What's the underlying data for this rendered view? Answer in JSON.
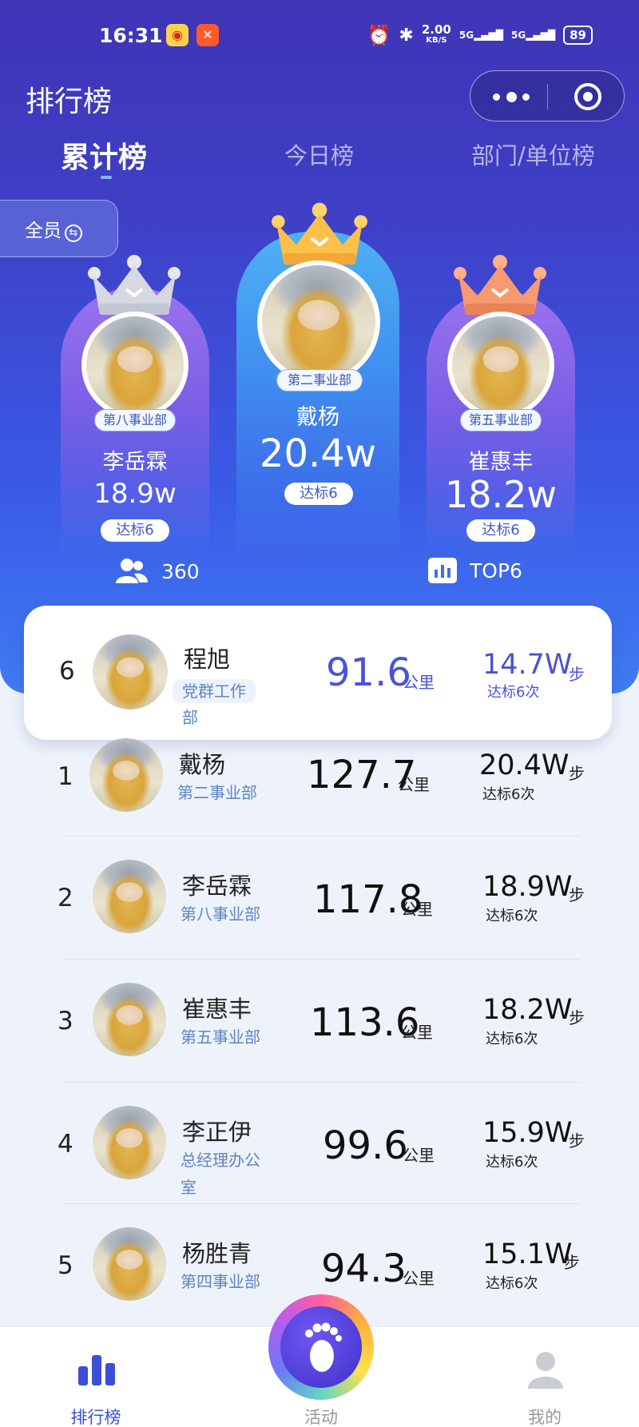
{
  "status_bar": {
    "time": "16:31",
    "network_speed": "2.00",
    "network_unit": "KB/S",
    "signal_1": "5G",
    "signal_2": "5G",
    "battery": "89",
    "icons": [
      "weibo-icon",
      "app-red-icon",
      "alarm-icon",
      "bluetooth-icon",
      "signal-icon",
      "battery-icon"
    ]
  },
  "nav": {
    "title": "排行榜"
  },
  "tabs": [
    {
      "label": "累计榜",
      "active": true
    },
    {
      "label": "今日榜",
      "active": false
    },
    {
      "label": "部门/单位榜",
      "active": false
    }
  ],
  "filter": {
    "label": "全员"
  },
  "podium": [
    {
      "position": 1,
      "dept": "第二事业部",
      "name": "戴杨",
      "steps": "20.4w",
      "badge": "达标6",
      "crown": "gold"
    },
    {
      "position": 2,
      "dept": "第八事业部",
      "name": "李岳霖",
      "steps": "18.9w",
      "badge": "达标6",
      "crown": "silver"
    },
    {
      "position": 3,
      "dept": "第五事业部",
      "name": "崔惠丰",
      "steps": "18.2w",
      "badge": "达标6",
      "crown": "bronze"
    }
  ],
  "stats": {
    "participants": "360",
    "top": "TOP6"
  },
  "my_rank": {
    "rank": "6",
    "name": "程旭",
    "dept": [
      "党群工作",
      "部"
    ],
    "km": "91.6",
    "km_unit": "公里",
    "steps": "14.7W",
    "steps_unit": "步",
    "times": "达标6次"
  },
  "list": [
    {
      "rank": "1",
      "name": "戴杨",
      "dept": [
        "第二事业部"
      ],
      "km": "127.7",
      "km_unit": "公里",
      "steps": "20.4W",
      "steps_unit": "步",
      "times": "达标6次"
    },
    {
      "rank": "2",
      "name": "李岳霖",
      "dept": [
        "第八事业部"
      ],
      "km": "117.8",
      "km_unit": "公里",
      "steps": "18.9W",
      "steps_unit": "步",
      "times": "达标6次"
    },
    {
      "rank": "3",
      "name": "崔惠丰",
      "dept": [
        "第五事业部"
      ],
      "km": "113.6",
      "km_unit": "公里",
      "steps": "18.2W",
      "steps_unit": "步",
      "times": "达标6次"
    },
    {
      "rank": "4",
      "name": "李正伊",
      "dept": [
        "总经理办公",
        "室"
      ],
      "km": "99.6",
      "km_unit": "公里",
      "steps": "15.9W",
      "steps_unit": "步",
      "times": "达标6次"
    },
    {
      "rank": "5",
      "name": "杨胜青",
      "dept": [
        "第四事业部"
      ],
      "km": "94.3",
      "km_unit": "公里",
      "steps": "15.1W",
      "steps_unit": "步",
      "times": "达标6次"
    }
  ],
  "bottom_nav": [
    {
      "label": "排行榜",
      "icon": "bar-chart-icon",
      "active": true
    },
    {
      "label": "活动",
      "icon": "footprint-icon",
      "active": false
    },
    {
      "label": "我的",
      "icon": "user-icon",
      "active": false
    }
  ],
  "colors": {
    "accent": "#4257c9",
    "active_tab": "#3b4fd8",
    "inactive_tab": "#999999",
    "dept_text": "#5f84c4"
  }
}
